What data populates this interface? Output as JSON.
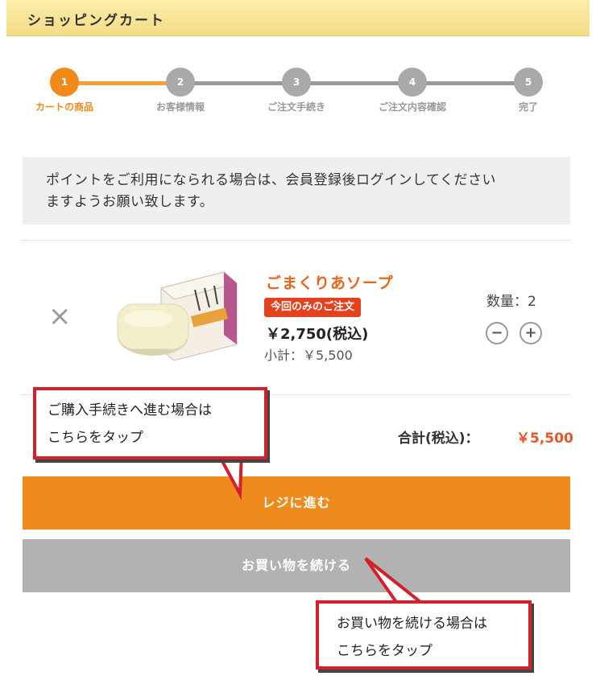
{
  "header": {
    "title": "ショッピングカート"
  },
  "steps": [
    {
      "num": "1",
      "label": "カートの商品",
      "active": true
    },
    {
      "num": "2",
      "label": "お客様情報",
      "active": false
    },
    {
      "num": "3",
      "label": "ご注文手続き",
      "active": false
    },
    {
      "num": "4",
      "label": "ご注文内容確認",
      "active": false
    },
    {
      "num": "5",
      "label": "完了",
      "active": false
    }
  ],
  "notice": {
    "line1": "ポイントをご利用になられる場合は、会員登録後ログインしてください",
    "line2": "ますようお願い致します。"
  },
  "cart": {
    "remove_icon": "×",
    "item": {
      "name": "ごまくりあソープ",
      "badge": "今回のみのご注文",
      "price": "￥2,750(税込)",
      "subtotal": "小計：￥5,500",
      "quantity_label": "数量：2",
      "minus_icon": "−",
      "plus_icon": "+"
    },
    "total_label": "合計(税込)：",
    "total_value": "￥5,500"
  },
  "buttons": {
    "checkout": "レジに進む",
    "continue": "お買い物を続ける"
  },
  "callouts": {
    "checkout_line1": "ご購入手続きへ進む場合は",
    "checkout_line2": "こちらをタップ",
    "continue_line1": "お買い物を続ける場合は",
    "continue_line2": "こちらをタップ"
  },
  "colors": {
    "accent": "#ef8b1c",
    "badge": "#e4421f",
    "callout_border": "#d41f2c",
    "header": "#f2dc86"
  }
}
